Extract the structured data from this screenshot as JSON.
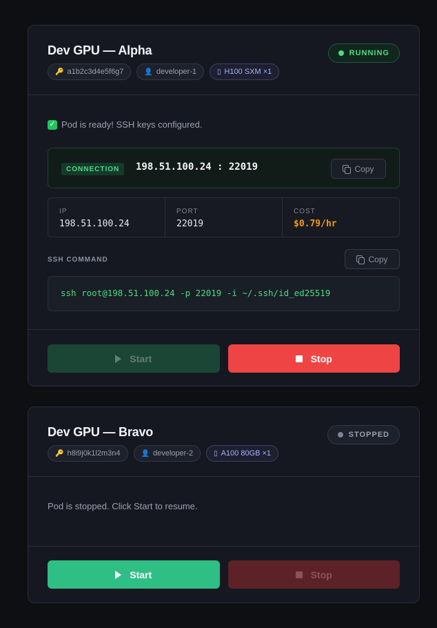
{
  "pods": [
    {
      "name": "Dev GPU — Alpha",
      "status": "RUNNING",
      "chips": {
        "id": "a1b2c3d4e5f6g7",
        "user": "developer-1",
        "gpu": "H100 SXM ×1"
      },
      "ready_message": "Pod is ready! SSH keys configured.",
      "connection": {
        "label": "CONNECTION",
        "value": "198.51.100.24 : 22019",
        "copy_label": "Copy"
      },
      "info": {
        "ip_label": "IP",
        "ip": "198.51.100.24",
        "port_label": "PORT",
        "port": "22019",
        "cost_label": "COST",
        "cost": "$0.79/hr"
      },
      "ssh": {
        "label": "SSH COMMAND",
        "command": "ssh root@198.51.100.24 -p 22019 -i ~/.ssh/id_ed25519",
        "copy_label": "Copy"
      },
      "actions": {
        "start_label": "Start",
        "stop_label": "Stop"
      }
    },
    {
      "name": "Dev GPU — Bravo",
      "status": "STOPPED",
      "chips": {
        "id": "h8i9j0k1l2m3n4",
        "user": "developer-2",
        "gpu": "A100 80GB ×1"
      },
      "stopped_message": "Pod is stopped. Click Start to resume.",
      "actions": {
        "start_label": "Start",
        "stop_label": "Stop"
      }
    }
  ],
  "icons": {
    "id_chip": "key-icon",
    "user_chip": "user-icon",
    "gpu_chip": "gpu-icon",
    "ready": "check-icon"
  },
  "colors": {
    "running": "#4ade80",
    "stop_red": "#ef4444",
    "start_green": "#2fbf84",
    "cost_amber": "#f59e0b",
    "gpu_chip": "#a5b4fc"
  }
}
